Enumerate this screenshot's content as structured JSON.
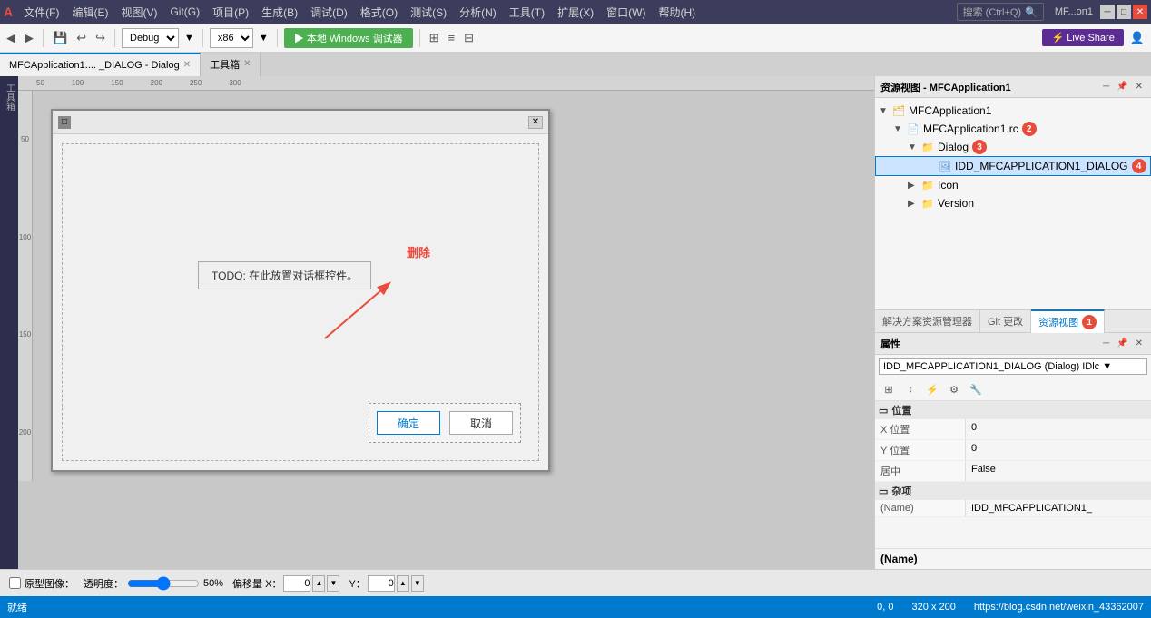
{
  "window": {
    "title": "MF...on1",
    "logo": "A"
  },
  "menu": {
    "items": [
      {
        "label": "文件(F)"
      },
      {
        "label": "编辑(E)"
      },
      {
        "label": "视图(V)"
      },
      {
        "label": "Git(G)"
      },
      {
        "label": "项目(P)"
      },
      {
        "label": "生成(B)"
      },
      {
        "label": "调试(D)"
      },
      {
        "label": "格式(O)"
      },
      {
        "label": "测试(S)"
      },
      {
        "label": "分析(N)"
      },
      {
        "label": "工具(T)"
      },
      {
        "label": "扩展(X)"
      },
      {
        "label": "窗口(W)"
      },
      {
        "label": "帮助(H)"
      }
    ],
    "search_placeholder": "搜索 (Ctrl+Q)"
  },
  "toolbar": {
    "config": "Debug",
    "platform": "x86",
    "run_label": "▶ 本地 Windows 调试器",
    "live_share_label": "⚡ Live Share"
  },
  "tabs": [
    {
      "label": "MFCApplication1.... _DIALOG - Dialog",
      "active": true
    },
    {
      "label": "工具箱",
      "active": false
    }
  ],
  "designer": {
    "dialog_title": "",
    "todo_text": "TODO: 在此放置对话框控件。",
    "delete_label": "删除",
    "ok_button": "确定",
    "cancel_button": "取消"
  },
  "bottom_bar": {
    "prototype_label": "原型图像：",
    "opacity_label": "透明度：",
    "opacity_value": "50%",
    "x_label": "偏移量 X：",
    "x_value": "0",
    "y_label": "Y：",
    "y_value": "0",
    "position_label": "0 , 0",
    "size_label": "320 x 200"
  },
  "resource_view": {
    "title": "资源视图 - MFCApplication1",
    "badge1": "1",
    "tree": [
      {
        "label": "MFCApplication1",
        "level": 0,
        "expanded": true,
        "type": "root",
        "badge": ""
      },
      {
        "label": "MFCApplication1.rc",
        "level": 1,
        "expanded": true,
        "type": "rc",
        "badge": "2"
      },
      {
        "label": "Dialog",
        "level": 2,
        "expanded": true,
        "type": "folder",
        "badge": "3"
      },
      {
        "label": "IDD_MFCAPPLICATION1_DIALOG",
        "level": 3,
        "expanded": false,
        "type": "item",
        "badge": "4",
        "selected": true
      },
      {
        "label": "Icon",
        "level": 2,
        "expanded": false,
        "type": "folder",
        "badge": ""
      },
      {
        "label": "Version",
        "level": 2,
        "expanded": false,
        "type": "folder",
        "badge": ""
      }
    ]
  },
  "bottom_tabs": [
    {
      "label": "解决方案资源管理器",
      "active": false
    },
    {
      "label": "Git 更改",
      "active": false
    },
    {
      "label": "资源视图",
      "active": true,
      "badge": "1"
    }
  ],
  "properties": {
    "title": "属性",
    "selector_text": "IDD_MFCAPPLICATION1_DIALOG (Dialog)  IDlc ▼",
    "sections": [
      {
        "name": "位置",
        "expanded": true,
        "rows": [
          {
            "name": "X 位置",
            "value": "0"
          },
          {
            "name": "Y 位置",
            "value": "0"
          },
          {
            "name": "居中",
            "value": "False"
          }
        ]
      },
      {
        "name": "杂项",
        "expanded": true,
        "rows": [
          {
            "name": "(Name)",
            "value": "IDD_MFCAPPLICATION1_"
          }
        ]
      }
    ],
    "footer_label": "(Name)"
  },
  "status_bar": {
    "status": "就绪",
    "position": "0, 0",
    "size": "320 x 200",
    "url": "https://blog.csdn.net/weixin_43362007"
  }
}
